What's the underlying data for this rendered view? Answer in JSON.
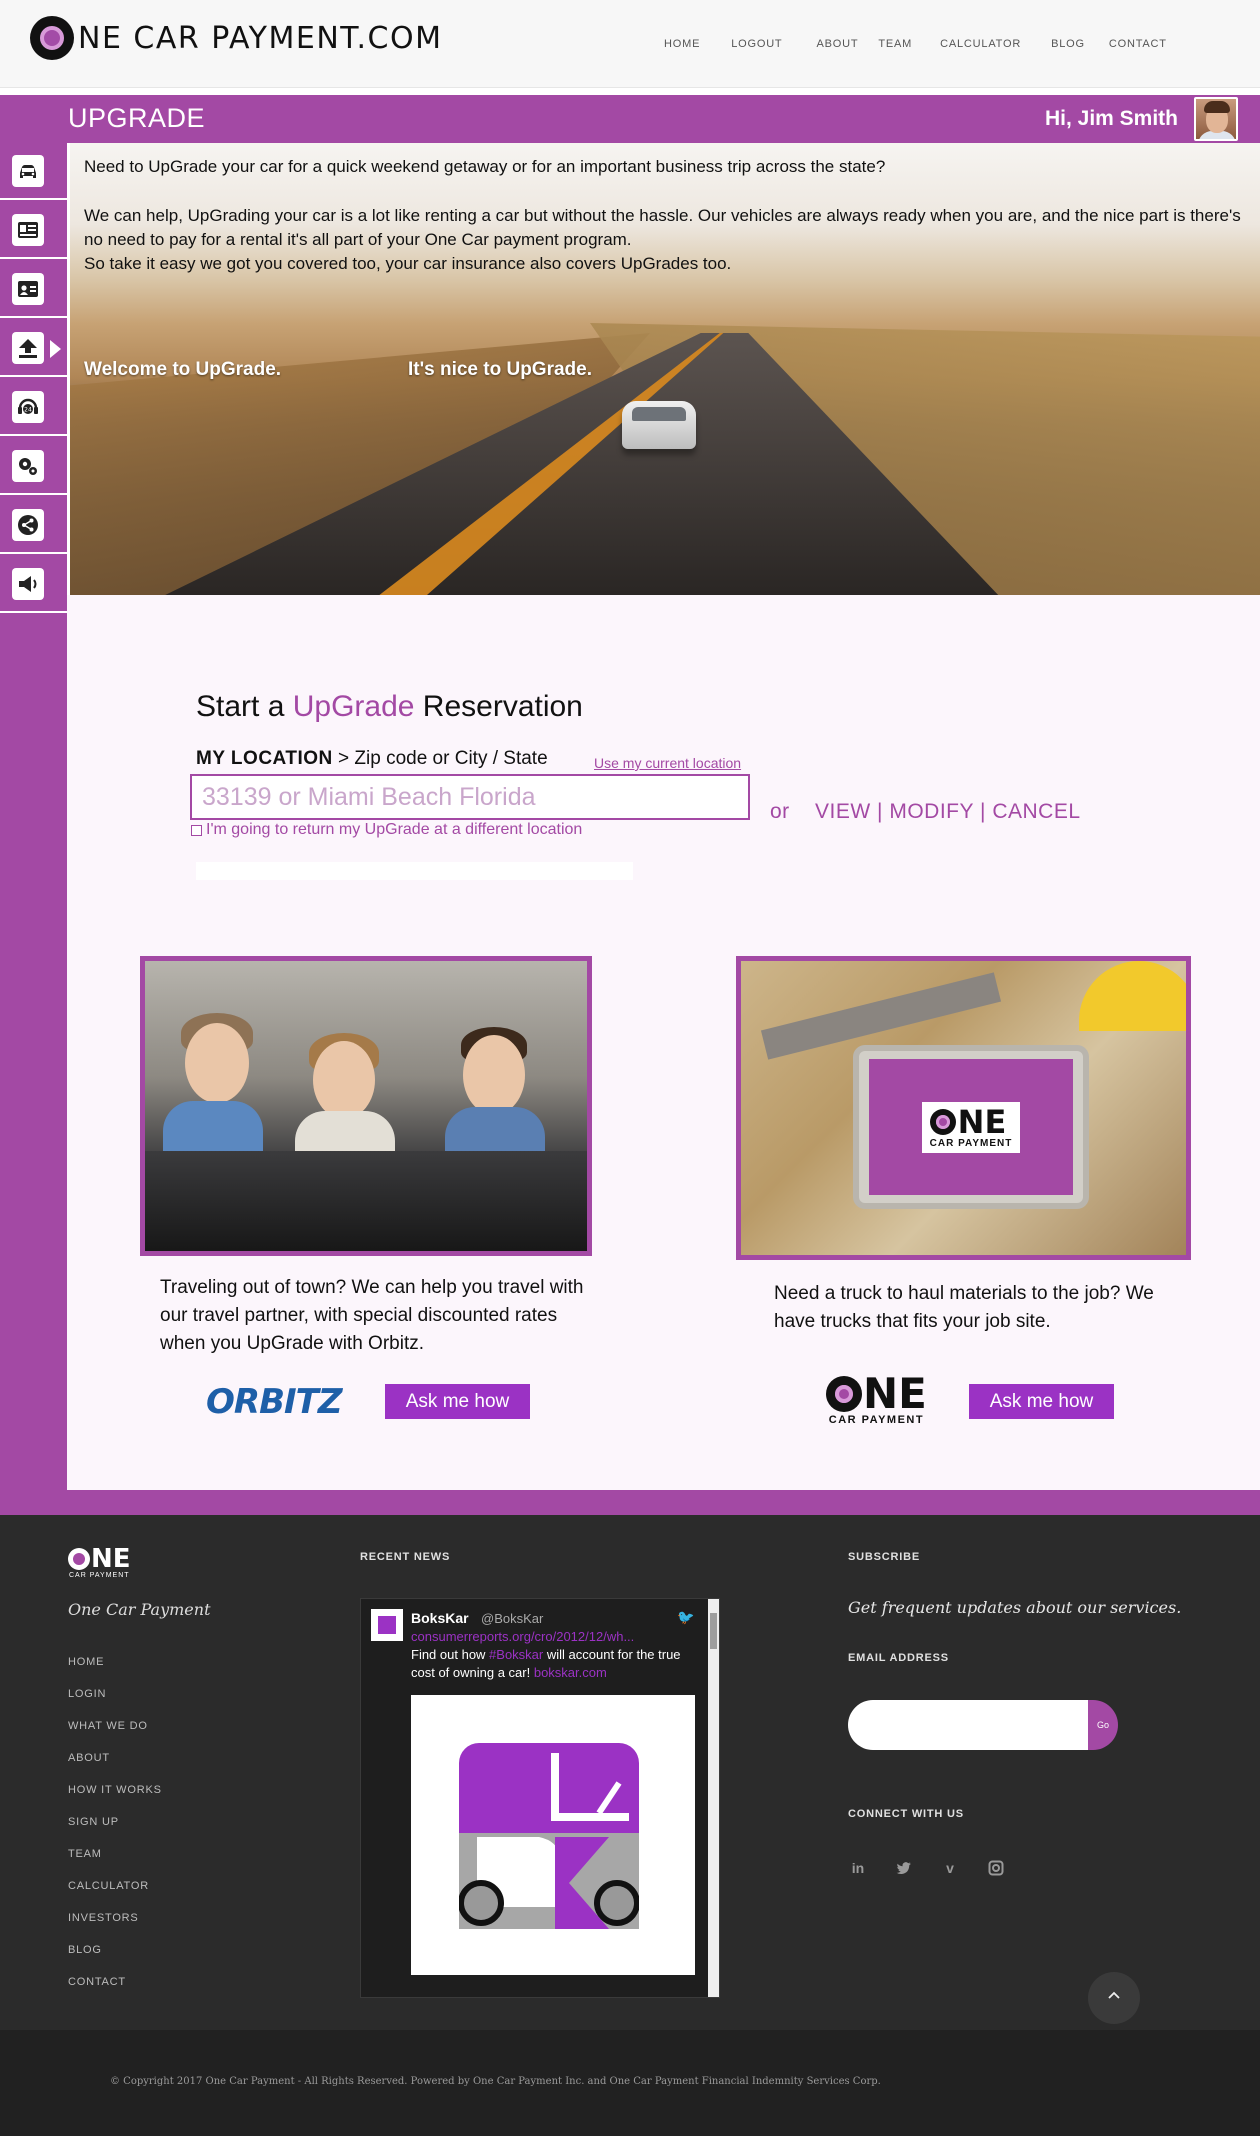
{
  "header": {
    "logo_text": "NE CAR PAYMENT.COM",
    "nav": [
      "HOME",
      "LOGOUT",
      "ABOUT",
      "TEAM",
      "CALCULATOR",
      "BLOG",
      "CONTACT"
    ]
  },
  "titlebar": {
    "page_title": "UPGRADE",
    "greeting": "Hi, Jim Smith"
  },
  "sidebar": {
    "icons": [
      "car-icon",
      "id-card-icon",
      "contact-card-icon",
      "upload-icon",
      "support-24-icon",
      "settings-icon",
      "share-icon",
      "megaphone-icon"
    ]
  },
  "hero": {
    "line1": "Need to UpGrade your car for a quick weekend getaway or for an important business trip across the state?",
    "line2": "We can help, UpGrading your car is a lot like renting a car but without the hassle.  Our vehicles are always ready when you are, and the nice part is there's no need to pay for a rental it's all part of your One Car payment program.",
    "line3": "So take it easy we got you covered too, your car insurance also covers UpGrades too.",
    "welcome": "Welcome to UpGrade.",
    "nice": "It's nice to UpGrade."
  },
  "reservation": {
    "title_start": "Start a ",
    "title_accent": "UpGrade",
    "title_end": " Reservation",
    "location_label": "MY LOCATION",
    "location_hint": " > Zip code or City / State",
    "use_current": "Use my current location",
    "placeholder": "33139 or Miami Beach Florida",
    "return_text": "I'm going to return my UpGrade at a different location",
    "or": "or",
    "view": "VIEW",
    "modify": "MODIFY",
    "cancel": "CANCEL",
    "sep": "|"
  },
  "promos": {
    "travel_text": "Traveling out of town?  We can help you travel with our travel partner, with special discounted rates when you UpGrade with Orbitz.",
    "orbitz_logo": "ORBITZ",
    "ask_label": "Ask me how",
    "truck_text": "Need a truck to haul materials to the job? We have trucks that fits your job site.",
    "one_logo_big": "NE",
    "one_logo_small": "CAR PAYMENT"
  },
  "footer": {
    "logo_big": "NE",
    "logo_small": "CAR PAYMENT",
    "brand": "One Car Payment",
    "links": [
      "HOME",
      "LOGIN",
      "WHAT WE DO",
      "ABOUT",
      "HOW IT WORKS",
      "SIGN UP",
      "TEAM",
      "CALCULATOR",
      "INVESTORS",
      "BLOG",
      "CONTACT"
    ],
    "recent_news": "RECENT NEWS",
    "subscribe": "SUBSCRIBE",
    "subscribe_text": "Get frequent updates about our services.",
    "email_label": "EMAIL ADDRESS",
    "go": "Go",
    "connect": "CONNECT WITH US",
    "social": [
      "in",
      "t",
      "v",
      "ig"
    ],
    "copyright": "© Copyright 2017 One Car Payment - All Rights Reserved. Powered by One Car Payment Inc. and One Car Payment Financial Indemnity Services Corp."
  },
  "tweet": {
    "name": "BoksKar",
    "handle": "@BoksKar",
    "link": "consumerreports.org/cro/2012/12/wh...",
    "body_pre": "Find out how ",
    "body_tag": "#Bokskar",
    "body_mid": " will account for the true cost of owning a car! ",
    "body_url": "bokskar.com"
  },
  "colors": {
    "accent": "#a349a4",
    "button": "#9b32c4",
    "footer_bg": "#2b2b2b"
  }
}
